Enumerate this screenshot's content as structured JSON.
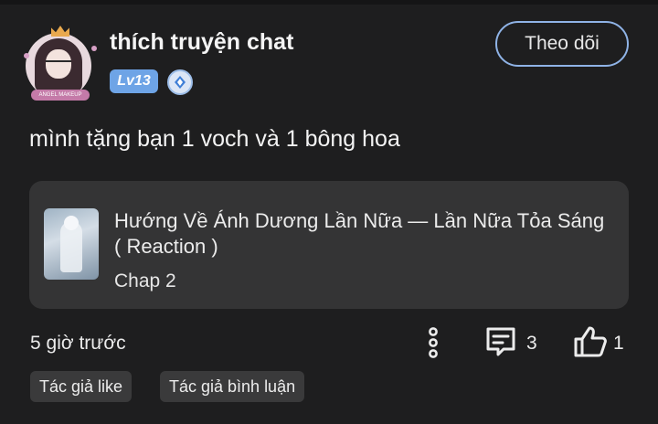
{
  "comment": {
    "username": "thích truyện chat",
    "level": "Lv13",
    "avatar_caption": "ANGEL MAKEUP",
    "follow_label": "Theo dõi",
    "text": "mình tặng bạn 1 voch và 1 bông hoa",
    "story": {
      "title": "Hướng Về Ánh Dương Lần Nữa — Lần Nữa Tỏa Sáng ( Reaction )",
      "chapter": "Chap 2"
    },
    "time": "5 giờ trước",
    "reply_count": "3",
    "like_count": "1",
    "tags": [
      "Tác giả like",
      "Tác giả bình luận"
    ]
  },
  "icons": {
    "more": "more-vertical-icon",
    "reply": "comment-icon",
    "like": "thumbs-up-icon",
    "rank": "rank-diamond-icon"
  },
  "colors": {
    "background": "#1e1e1f",
    "card": "#343435",
    "accent": "#8fb3e6",
    "level_badge": "#6ea4e6"
  }
}
